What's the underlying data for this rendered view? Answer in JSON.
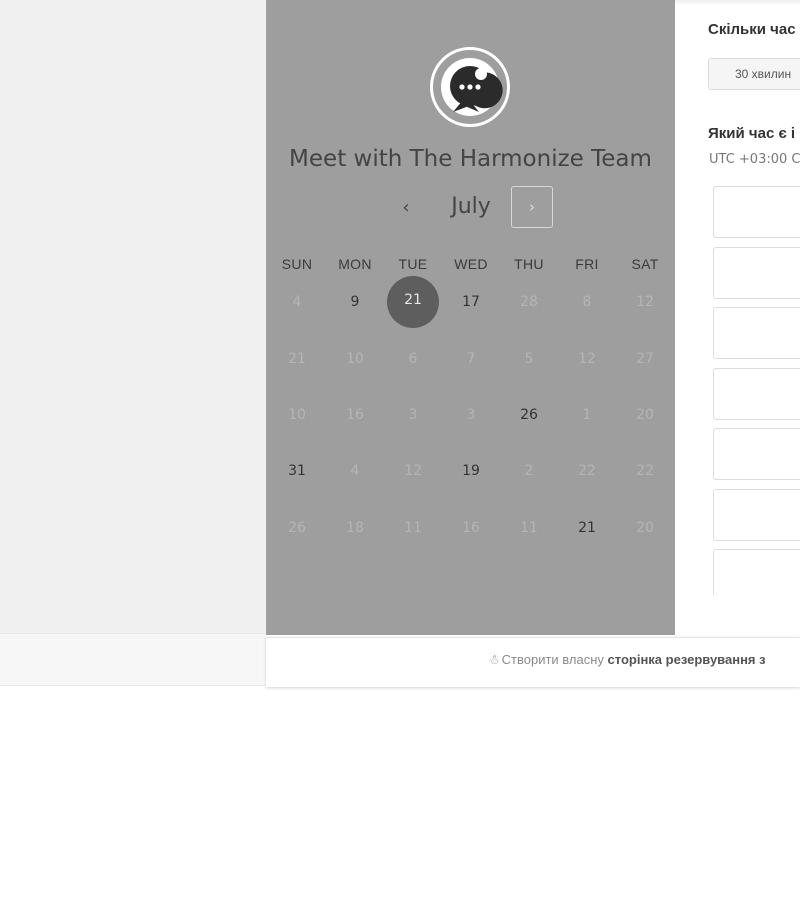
{
  "calendar": {
    "title": "Meet with The Harmonize Team",
    "month": "July",
    "prev_icon": "‹",
    "next_icon": "›",
    "weekdays": [
      "SUN",
      "MON",
      "TUE",
      "WED",
      "THU",
      "FRI",
      "SAT"
    ],
    "weeks": [
      [
        {
          "d": "4",
          "a": false
        },
        {
          "d": "9",
          "a": true
        },
        {
          "d": "21",
          "a": true,
          "s": true
        },
        {
          "d": "17",
          "a": true
        },
        {
          "d": "28",
          "a": false
        },
        {
          "d": "8",
          "a": false
        },
        {
          "d": "12",
          "a": false
        }
      ],
      [
        {
          "d": "21",
          "a": false
        },
        {
          "d": "10",
          "a": false
        },
        {
          "d": "6",
          "a": false
        },
        {
          "d": "7",
          "a": false
        },
        {
          "d": "5",
          "a": false
        },
        {
          "d": "12",
          "a": false
        },
        {
          "d": "27",
          "a": false
        }
      ],
      [
        {
          "d": "10",
          "a": false
        },
        {
          "d": "16",
          "a": false
        },
        {
          "d": "3",
          "a": false
        },
        {
          "d": "3",
          "a": false
        },
        {
          "d": "26",
          "a": true
        },
        {
          "d": "1",
          "a": false
        },
        {
          "d": "20",
          "a": false
        }
      ],
      [
        {
          "d": "31",
          "a": true
        },
        {
          "d": "4",
          "a": false
        },
        {
          "d": "12",
          "a": false
        },
        {
          "d": "19",
          "a": true
        },
        {
          "d": "2",
          "a": false
        },
        {
          "d": "22",
          "a": false
        },
        {
          "d": "22",
          "a": false
        }
      ],
      [
        {
          "d": "26",
          "a": false
        },
        {
          "d": "18",
          "a": false
        },
        {
          "d": "11",
          "a": false
        },
        {
          "d": "16",
          "a": false
        },
        {
          "d": "11",
          "a": false
        },
        {
          "d": "21",
          "a": true
        },
        {
          "d": "20",
          "a": false
        }
      ]
    ]
  },
  "booking": {
    "duration_question": "Скільки час",
    "duration_option": "30 хвилин",
    "time_question": "Який час є і",
    "timezone": "UTC +03:00 С"
  },
  "footer": {
    "text_prefix": "Створити власну ",
    "text_bold": "сторінка резервування з"
  },
  "icons": {
    "avatar": "chat-bubble-icon",
    "footer": "hubspot-sprocket-icon"
  },
  "colors": {
    "panel": "#9e9e9e",
    "selected_day": "#5e5e5e",
    "available_day": "#333333",
    "unavailable_day": "#b5b5b5"
  }
}
